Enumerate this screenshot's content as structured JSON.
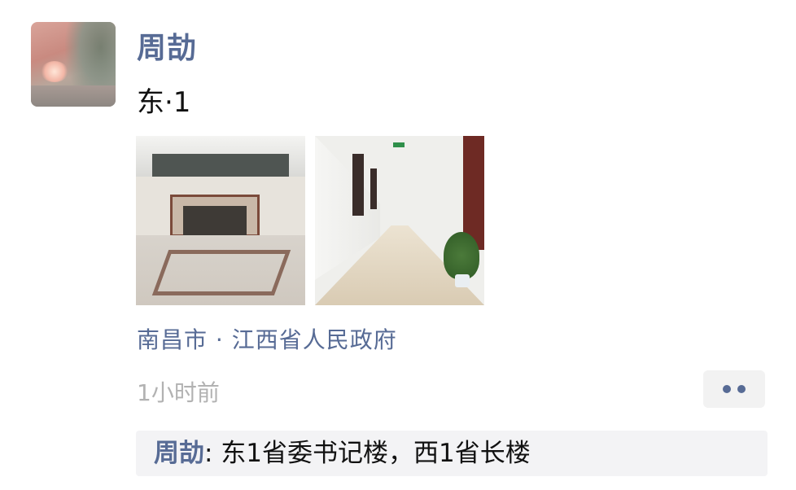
{
  "post": {
    "author": "周劼",
    "text": "东·1",
    "location": "南昌市 · 江西省人民政府",
    "time": "1小时前"
  },
  "photos": [
    {
      "icon": "building-lobby-photo"
    },
    {
      "icon": "corridor-photo"
    }
  ],
  "comments": [
    {
      "author": "周劼",
      "separator": ": ",
      "text": "东1省委书记楼，西1省长楼"
    }
  ],
  "colors": {
    "link": "#576b95",
    "muted": "#b2b2b2",
    "comment_bg": "#f3f3f5"
  }
}
